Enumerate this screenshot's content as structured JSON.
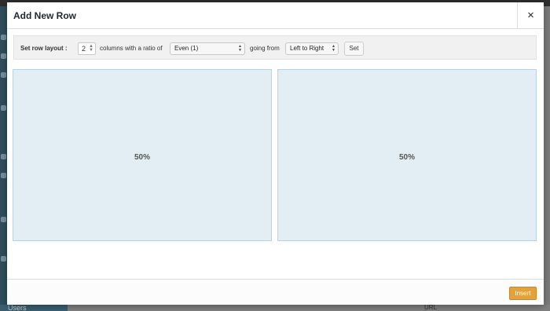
{
  "background": {
    "sidebar_bottom_label": "Users",
    "right_label": "URL"
  },
  "modal": {
    "title": "Add New Row",
    "close_glyph": "×"
  },
  "layout_bar": {
    "label": "Set row layout :",
    "columns_value": "2",
    "columns_text": "columns with a ratio of",
    "ratio_selected": "Even (1)",
    "going_from_text": "going from",
    "direction_selected": "Left to Right",
    "set_button": "Set"
  },
  "columns": [
    {
      "label": "50%"
    },
    {
      "label": "50%"
    }
  ],
  "footer": {
    "insert_button": "Insert"
  },
  "colors": {
    "accent": "#e4a33a",
    "column_bg": "#e2eef3",
    "column_border": "#b9d2de"
  }
}
